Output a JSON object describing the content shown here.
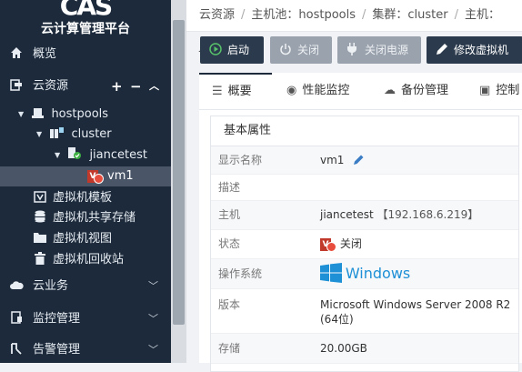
{
  "sidebar": {
    "brand": "云计算管理平台",
    "logo_text": "CAS",
    "items": {
      "overview": "概览",
      "cloud_resources": "云资源",
      "cloud_business": "云业务",
      "monitoring": "监控管理",
      "alerts": "告警管理"
    },
    "tree": {
      "hostpools": "hostpools",
      "cluster": "cluster",
      "host": "jiancetest",
      "vm": "vm1"
    },
    "sub_items": {
      "vm_template": "虚拟机模板",
      "vm_shared_storage": "虚拟机共享存储",
      "vm_view": "虚拟机视图",
      "vm_recycle": "虚拟机回收站"
    },
    "controls": {
      "add": "+",
      "remove": "−"
    }
  },
  "breadcrumb": {
    "root": "云资源",
    "pool": "主机池：hostpools",
    "cluster": "集群：cluster",
    "host": "主机：jiancetest"
  },
  "toolbar": {
    "start": "启动",
    "shutdown": "关闭",
    "power_off": "关闭电源",
    "modify_vm": "修改虚拟机"
  },
  "tabs": {
    "overview": "概要",
    "performance": "性能监控",
    "backup": "备份管理",
    "console": "控制"
  },
  "basic": {
    "title": "基本属性",
    "rows": {
      "display_name": {
        "label": "显示名称",
        "value": "vm1"
      },
      "description": {
        "label": "描述",
        "value": ""
      },
      "host": {
        "label": "主机",
        "value": "jiancetest",
        "ip": "【192.168.6.219】"
      },
      "status": {
        "label": "状态",
        "value": "关闭"
      },
      "os": {
        "label": "操作系统",
        "value": "Windows"
      },
      "version": {
        "label": "版本",
        "value_line1": "Microsoft Windows Server 2008 R2",
        "value_line2": "(64位)"
      },
      "storage": {
        "label": "存储",
        "value": "20.00GB"
      }
    }
  },
  "colors": {
    "sidebar_bg": "#1c2a3b",
    "toolbar_dark": "#2b3a4c",
    "toolbar_disabled": "#9aa2ad",
    "windows_blue": "#1e90d6",
    "status_red": "#c0392b"
  }
}
